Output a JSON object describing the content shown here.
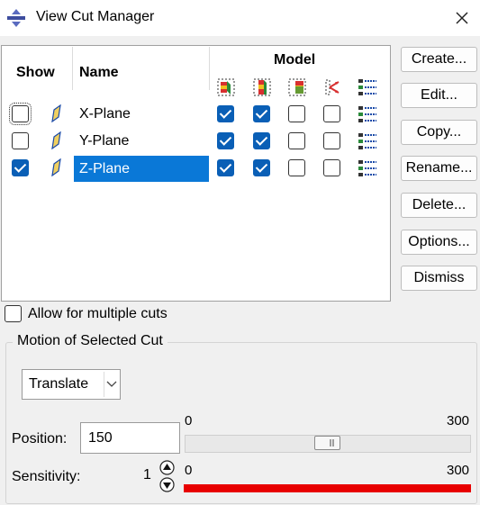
{
  "window": {
    "title": "View Cut Manager"
  },
  "table": {
    "headers": {
      "show": "Show",
      "name": "Name",
      "model": "Model"
    },
    "rows": [
      {
        "name": "X-Plane",
        "show": false,
        "model": [
          true,
          true,
          false,
          false
        ],
        "selected": false
      },
      {
        "name": "Y-Plane",
        "show": false,
        "model": [
          true,
          true,
          false,
          false
        ],
        "selected": false
      },
      {
        "name": "Z-Plane",
        "show": true,
        "model": [
          true,
          true,
          false,
          false
        ],
        "selected": true
      }
    ],
    "model_icons": [
      "cut-below-icon",
      "cut-on-icon",
      "cut-above-icon",
      "free-body-icon",
      "options-list-icon"
    ]
  },
  "buttons": {
    "create": "Create...",
    "edit": "Edit...",
    "copy": "Copy...",
    "rename": "Rename...",
    "delete": "Delete...",
    "options": "Options...",
    "dismiss": "Dismiss"
  },
  "multiple_cuts": {
    "label": "Allow for multiple cuts",
    "checked": false
  },
  "motion": {
    "title": "Motion of Selected Cut",
    "mode": "Translate",
    "position": {
      "label": "Position:",
      "value": "150",
      "min": "0",
      "max": "300",
      "slider_fraction": 0.5
    },
    "sensitivity": {
      "label": "Sensitivity:",
      "value": "1",
      "min": "0",
      "max": "300"
    }
  },
  "colors": {
    "accent": "#0a78d7",
    "checkbox": "#0a5fb6",
    "sensitivity_bar": "#e80000"
  }
}
